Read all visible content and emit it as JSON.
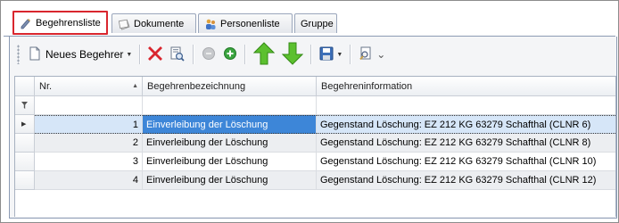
{
  "tabs": [
    {
      "label": "Begehrensliste",
      "icon": "list-pencil-icon",
      "active": true
    },
    {
      "label": "Dokumente",
      "icon": "documents-icon",
      "active": false
    },
    {
      "label": "Personenliste",
      "icon": "people-icon",
      "active": false
    },
    {
      "label": "Gruppe",
      "icon": "",
      "active": false
    }
  ],
  "toolbar": {
    "new_label": "Neues Begehrer",
    "icons": [
      "new-document-icon",
      "delete-icon",
      "preview-icon",
      "disabled-circle-icon",
      "add-circle-icon",
      "arrow-up-icon",
      "arrow-down-icon",
      "save-icon",
      "search-document-icon"
    ]
  },
  "grid": {
    "columns": [
      "Nr.",
      "Begehrenbezeichnung",
      "Begehreninformation"
    ],
    "rows": [
      {
        "nr": "1",
        "bezeichnung": "Einverleibung der Löschung",
        "information": "Gegenstand Löschung: EZ 212 KG 63279 Schafthal (CLNR 6)"
      },
      {
        "nr": "2",
        "bezeichnung": "Einverleibung der Löschung",
        "information": "Gegenstand Löschung: EZ 212 KG 63279 Schafthal (CLNR 8)"
      },
      {
        "nr": "3",
        "bezeichnung": "Einverleibung der Löschung",
        "information": "Gegenstand Löschung: EZ 212 KG 63279 Schafthal (CLNR 10)"
      },
      {
        "nr": "4",
        "bezeichnung": "Einverleibung der Löschung",
        "information": "Gegenstand Löschung: EZ 212 KG 63279 Schafthal (CLNR 12)"
      }
    ],
    "selected_row": 0
  },
  "colors": {
    "accent_red": "#d9262e",
    "selection_blue": "#3d86d8",
    "selection_light": "#d6e6f8",
    "row_alt": "#eceef1"
  }
}
